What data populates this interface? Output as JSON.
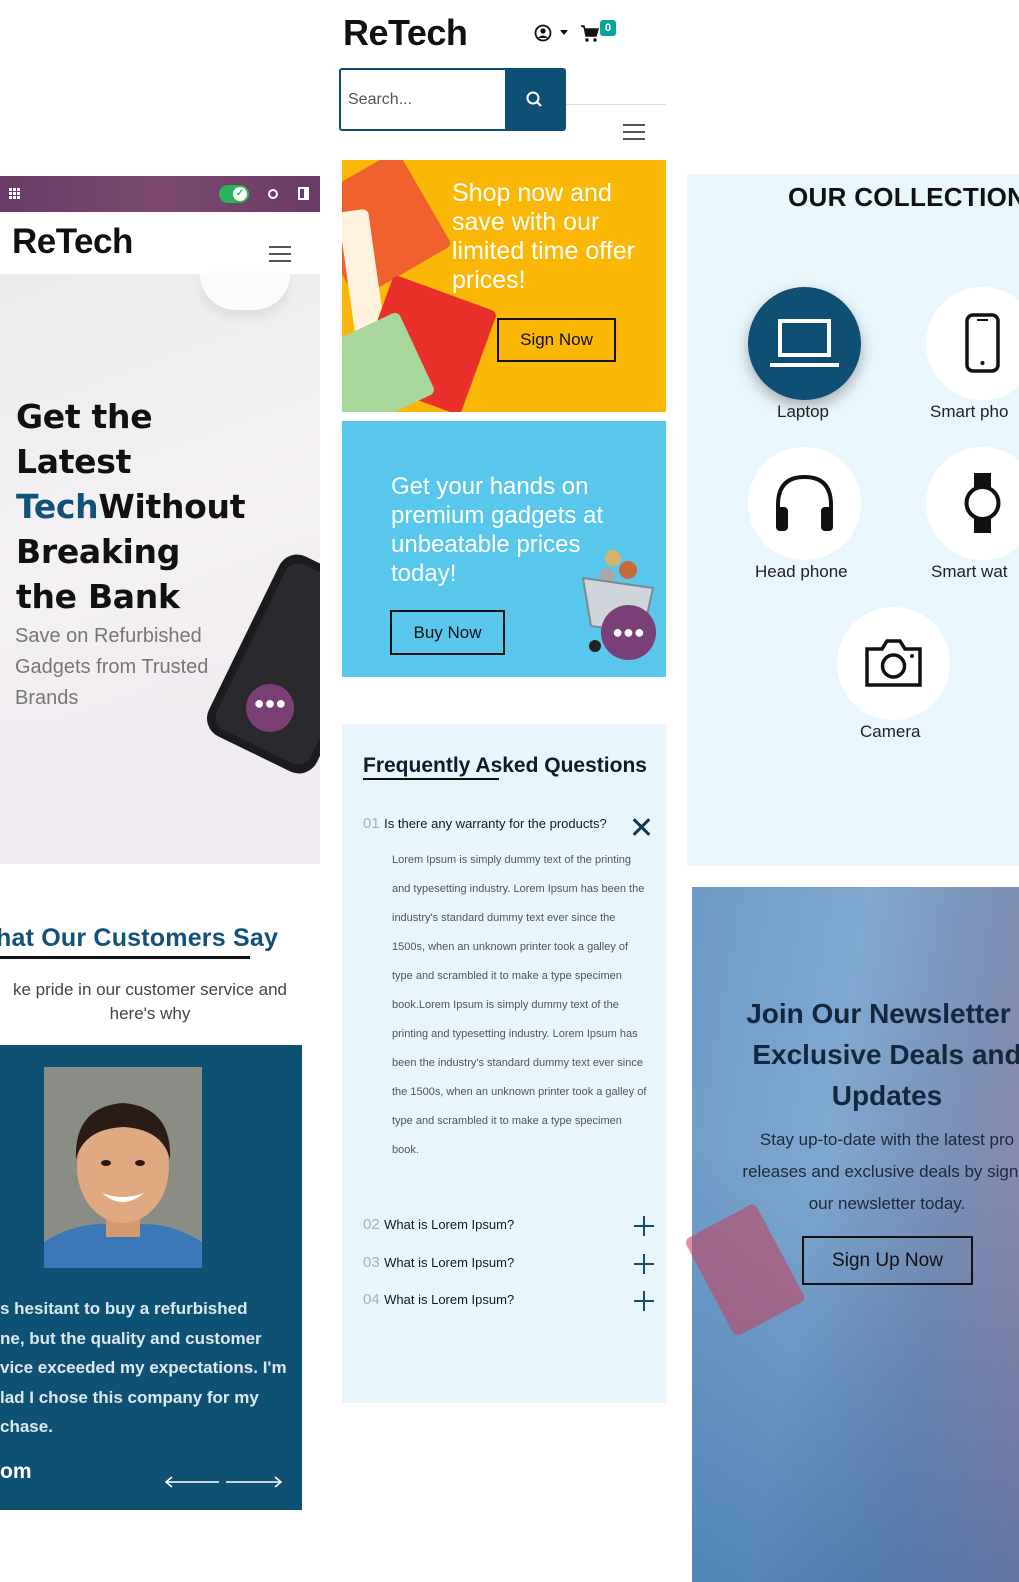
{
  "left_mobile": {
    "logo": "ReTech",
    "hero": {
      "headline_line1": "Get the",
      "headline_line2": "Latest",
      "headline_highlight": "Tech",
      "headline_line3": "Without",
      "headline_line4": "Breaking",
      "headline_line5": "the Bank",
      "subtext": "Save on Refurbished Gadgets from Trusted Brands"
    }
  },
  "testimonials": {
    "title": "hat Our Customers Say",
    "subtitle": "ke pride in our customer service and here's why",
    "quote": "s hesitant to buy a refurbished\nne, but the quality and customer\nvice exceeded my expectations. I'm\nlad I chose this company for my\nchase.",
    "author": "om"
  },
  "header": {
    "logo": "ReTech",
    "cart_count": "0",
    "search_placeholder": "Search..."
  },
  "promos": [
    {
      "text": "Shop now and save with our limited time offer prices!",
      "button": "Sign Now",
      "color": "#fbb705"
    },
    {
      "text": "Get your hands on premium gadgets at unbeatable prices today!",
      "button": "Buy Now",
      "color": "#59c6eb"
    }
  ],
  "faq": {
    "title": "Frequently Asked Questions",
    "items": [
      {
        "num": "01",
        "question": "Is there any warranty for the products?",
        "expanded": true,
        "answer": "Lorem Ipsum is simply dummy text of the printing and typesetting industry. Lorem Ipsum has been the industry's standard dummy text ever since the 1500s, when an unknown printer took a galley of type and scrambled it to make a type specimen book.Lorem Ipsum is simply dummy text of the printing and typesetting industry. Lorem Ipsum has been the industry's standard dummy text ever since the 1500s, when an unknown printer took a galley of type and scrambled it to make a type specimen book."
      },
      {
        "num": "02",
        "question": "What is Lorem Ipsum?",
        "expanded": false
      },
      {
        "num": "03",
        "question": "What is Lorem Ipsum?",
        "expanded": false
      },
      {
        "num": "04",
        "question": "What is Lorem Ipsum?",
        "expanded": false
      }
    ]
  },
  "collection": {
    "title": "OUR COLLECTION",
    "categories": [
      {
        "label": "Laptop",
        "icon": "laptop-icon",
        "active": true
      },
      {
        "label": "Smart pho",
        "icon": "smartphone-icon",
        "active": false
      },
      {
        "label": "Head phone",
        "icon": "headphone-icon",
        "active": false
      },
      {
        "label": "Smart wat",
        "icon": "smartwatch-icon",
        "active": false
      },
      {
        "label": "Camera",
        "icon": "camera-icon",
        "active": false
      }
    ]
  },
  "newsletter": {
    "title_line1": "Join Our Newsletter f",
    "title_line2": "Exclusive Deals and",
    "title_line3": "Updates",
    "text_line1": "Stay up-to-date with the latest pro",
    "text_line2": "releases and exclusive deals by signin",
    "text_line3": "our newsletter today.",
    "button": "Sign Up Now"
  },
  "colors": {
    "brand_navy": "#0f4f73",
    "admin_purple": "#6a3a68",
    "chat_purple": "#7b3f77",
    "cart_badge": "#0aa39a"
  }
}
